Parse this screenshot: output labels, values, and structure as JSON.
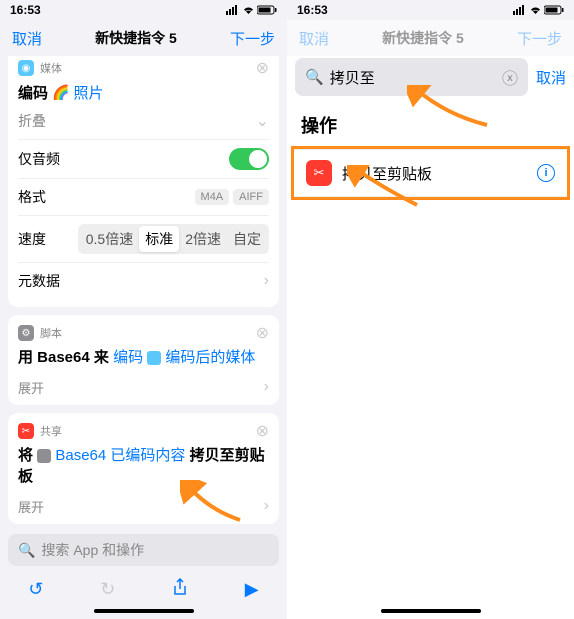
{
  "status": {
    "time": "16:53"
  },
  "left": {
    "nav": {
      "cancel": "取消",
      "title": "新快捷指令 5",
      "next": "下一步"
    },
    "card1": {
      "category": "媒体",
      "title_prefix": "编码",
      "title_link": "照片",
      "rows": {
        "fold": "折叠",
        "audio_only": "仅音频",
        "format": "格式",
        "format_opts": [
          "M4A",
          "AIFF"
        ],
        "speed": "速度",
        "speed_opts": [
          "0.5倍速",
          "标准",
          "2倍速",
          "自定"
        ],
        "meta": "元数据"
      }
    },
    "card2": {
      "category": "脚本",
      "t1": "用 Base64 来",
      "t2": "编码",
      "t3": "编码后的媒体",
      "expand": "展开"
    },
    "card3": {
      "category": "共享",
      "t1": "将",
      "t2": "Base64 已编码内容",
      "t3": "拷贝至剪贴板",
      "expand": "展开"
    },
    "search_placeholder": "搜索 App 和操作"
  },
  "right": {
    "cancel": "取消",
    "search_value": "拷贝至",
    "section": "操作",
    "result": "拷贝至剪贴板"
  }
}
